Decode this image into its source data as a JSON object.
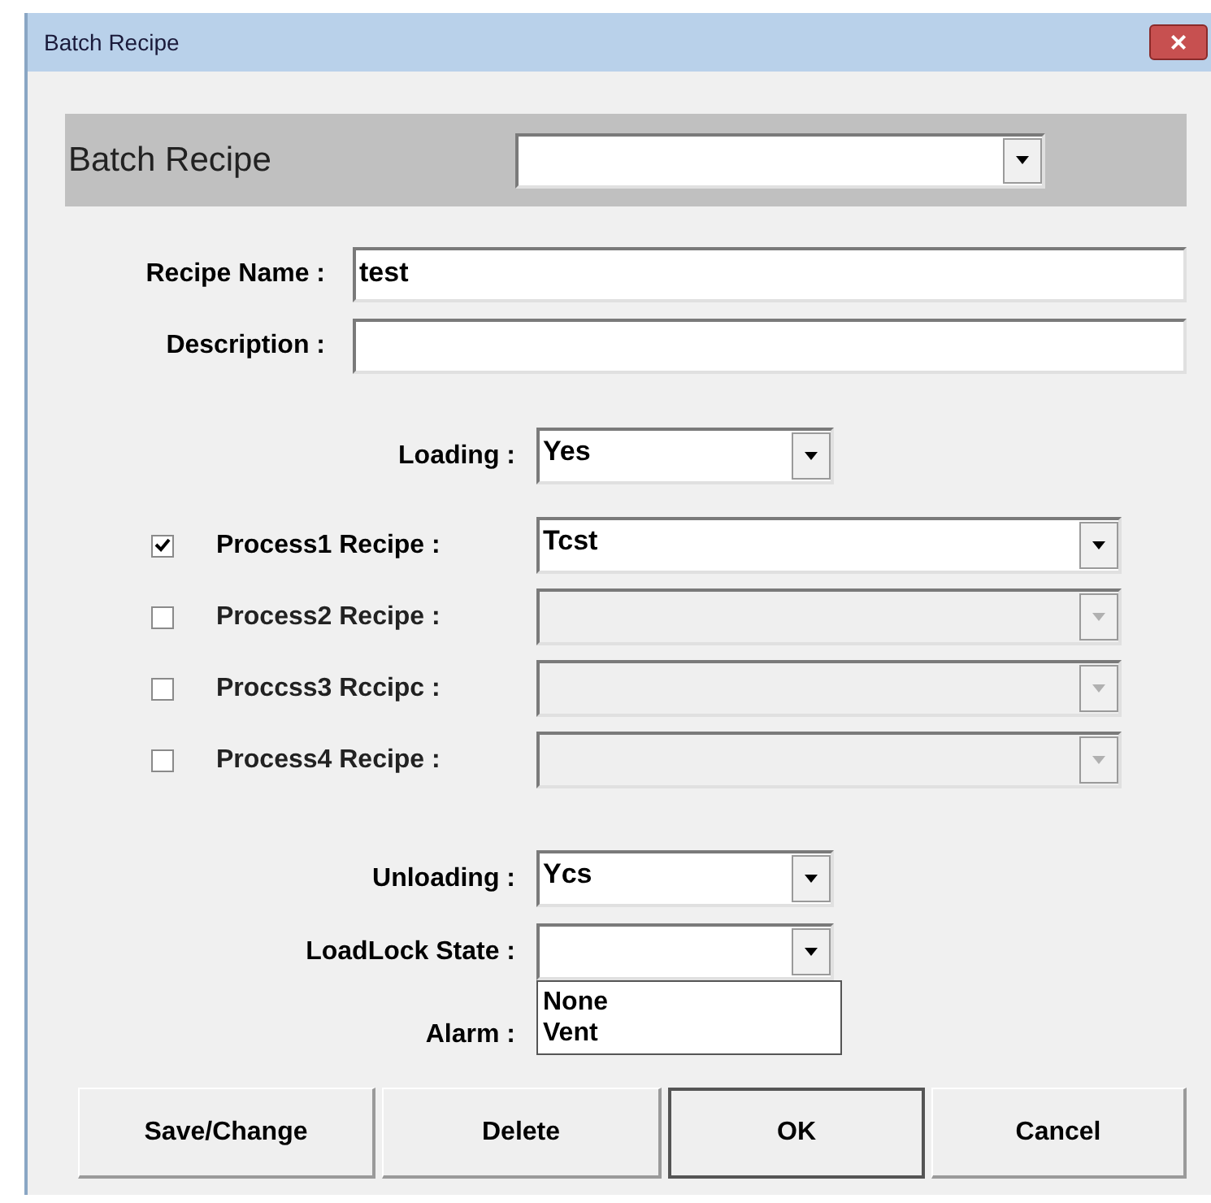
{
  "window": {
    "title": "Batch Recipe",
    "close": "×"
  },
  "header": {
    "label": "Batch Recipe"
  },
  "fields": [
    {
      "label": "Recipe Name :",
      "value": "test"
    },
    {
      "label": "Description :"
    }
  ],
  "loading": {
    "label": "Loading :",
    "value": "Yes"
  },
  "processes": [
    {
      "label": "Process1 Recipe :",
      "checked": true,
      "value": "Tcst"
    },
    {
      "label": "Process2 Recipe :",
      "checked": false
    },
    {
      "label": "Proccss3 Rccipc :",
      "checked": false
    },
    {
      "label": "Process4 Recipe :",
      "checked": false
    }
  ],
  "unloading": {
    "label": "Unloading :",
    "value": "Ycs"
  },
  "loadlock": {
    "label": "LoadLock State :",
    "expanded": true,
    "options": [
      "None",
      "Vent"
    ]
  },
  "alarm": {
    "label": "Alarm :"
  },
  "buttons": [
    {
      "label": "Save/Change",
      "default": false
    },
    {
      "label": "Delete",
      "default": false
    },
    {
      "label": "OK",
      "default": true
    },
    {
      "label": "Cancel",
      "default": false
    }
  ]
}
